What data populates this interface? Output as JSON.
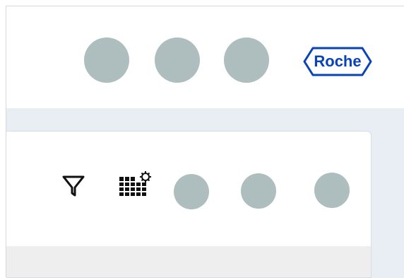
{
  "header": {
    "logo_text": "Roche",
    "brand_color": "#0a43b6",
    "avatar_color": "#aebdbd",
    "avatars": [
      "avatar",
      "avatar",
      "avatar"
    ]
  },
  "toolbar": {
    "icons": [
      "filter-icon",
      "column-settings-icon"
    ],
    "avatars": [
      "avatar",
      "avatar",
      "avatar"
    ]
  },
  "colors": {
    "workspace_bg": "#e9eef4",
    "panel_bg": "#ffffff",
    "footer_bg": "#eeeeee"
  }
}
